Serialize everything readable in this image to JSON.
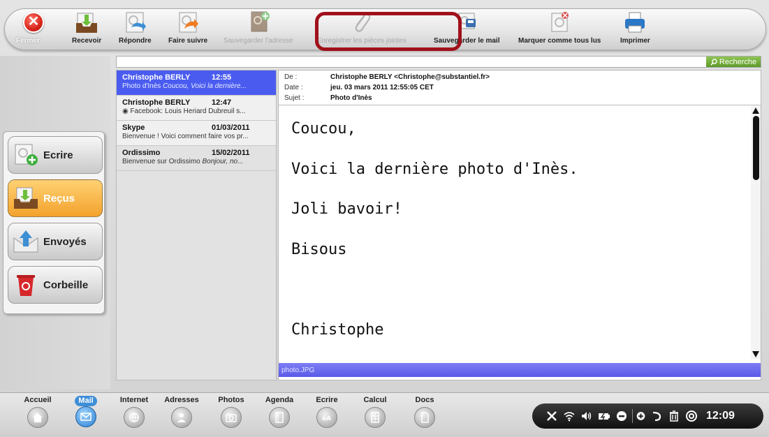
{
  "toolbar": {
    "close_label": "Fermer",
    "receive_label": "Recevoir",
    "reply_label": "Répondre",
    "forward_label": "Faire suivre",
    "save_address_label": "Sauvegarder l'adresse",
    "save_attachments_label": "Enregistrer les pièces jointes",
    "save_mail_label": "Sauvegarder le mail",
    "mark_all_read_label": "Marquer comme tous lus",
    "print_label": "Imprimer"
  },
  "search": {
    "button_label": "Recherche"
  },
  "sidebar": {
    "items": [
      {
        "label": "Ecrire"
      },
      {
        "label": "Reçus"
      },
      {
        "label": "Envoyés"
      },
      {
        "label": "Corbeille"
      }
    ]
  },
  "messages": [
    {
      "from": "Christophe BERLY",
      "time": "12:55",
      "preview": "Photo d'Inès",
      "preview_extra": "Coucou, Voici la dernière..."
    },
    {
      "from": "Christophe BERLY",
      "time": "12:47",
      "preview": "◉  Facebook: Louis Heriard Dubreuil s...",
      "preview_extra": ""
    },
    {
      "from": "Skype",
      "time": "01/03/2011",
      "preview": "Bienvenue ! Voici comment faire vos pr...",
      "preview_extra": ""
    },
    {
      "from": "Ordissimo",
      "time": "15/02/2011",
      "preview": "Bienvenue sur Ordissimo",
      "preview_extra": "Bonjour, no..."
    }
  ],
  "email": {
    "from_key": "De :",
    "from_value": "Christophe BERLY <Christophe@substantiel.fr>",
    "date_key": "Date :",
    "date_value": "jeu. 03 mars 2011 12:55:05 CET",
    "subject_key": "Sujet :",
    "subject_value": "Photo d'Inès",
    "body": [
      "Coucou,",
      "Voici la dernière photo d'Inès.",
      "Joli bavoir!",
      "Bisous",
      "Christophe"
    ],
    "attachment": "photo.JPG"
  },
  "dock": {
    "items": [
      {
        "label": "Accueil"
      },
      {
        "label": "Mail"
      },
      {
        "label": "Internet"
      },
      {
        "label": "Adresses"
      },
      {
        "label": "Photos"
      },
      {
        "label": "Agenda"
      },
      {
        "label": "Ecrire"
      },
      {
        "label": "Calcul"
      },
      {
        "label": "Docs"
      }
    ]
  },
  "tray": {
    "clock": "12:09"
  },
  "colors": {
    "selected_message": "#4a5cf0",
    "active_folder": "#f3a22c",
    "search_button": "#5d9a27",
    "attachment_bar": "#5a5ae8",
    "highlight_frame": "#a0111b"
  }
}
